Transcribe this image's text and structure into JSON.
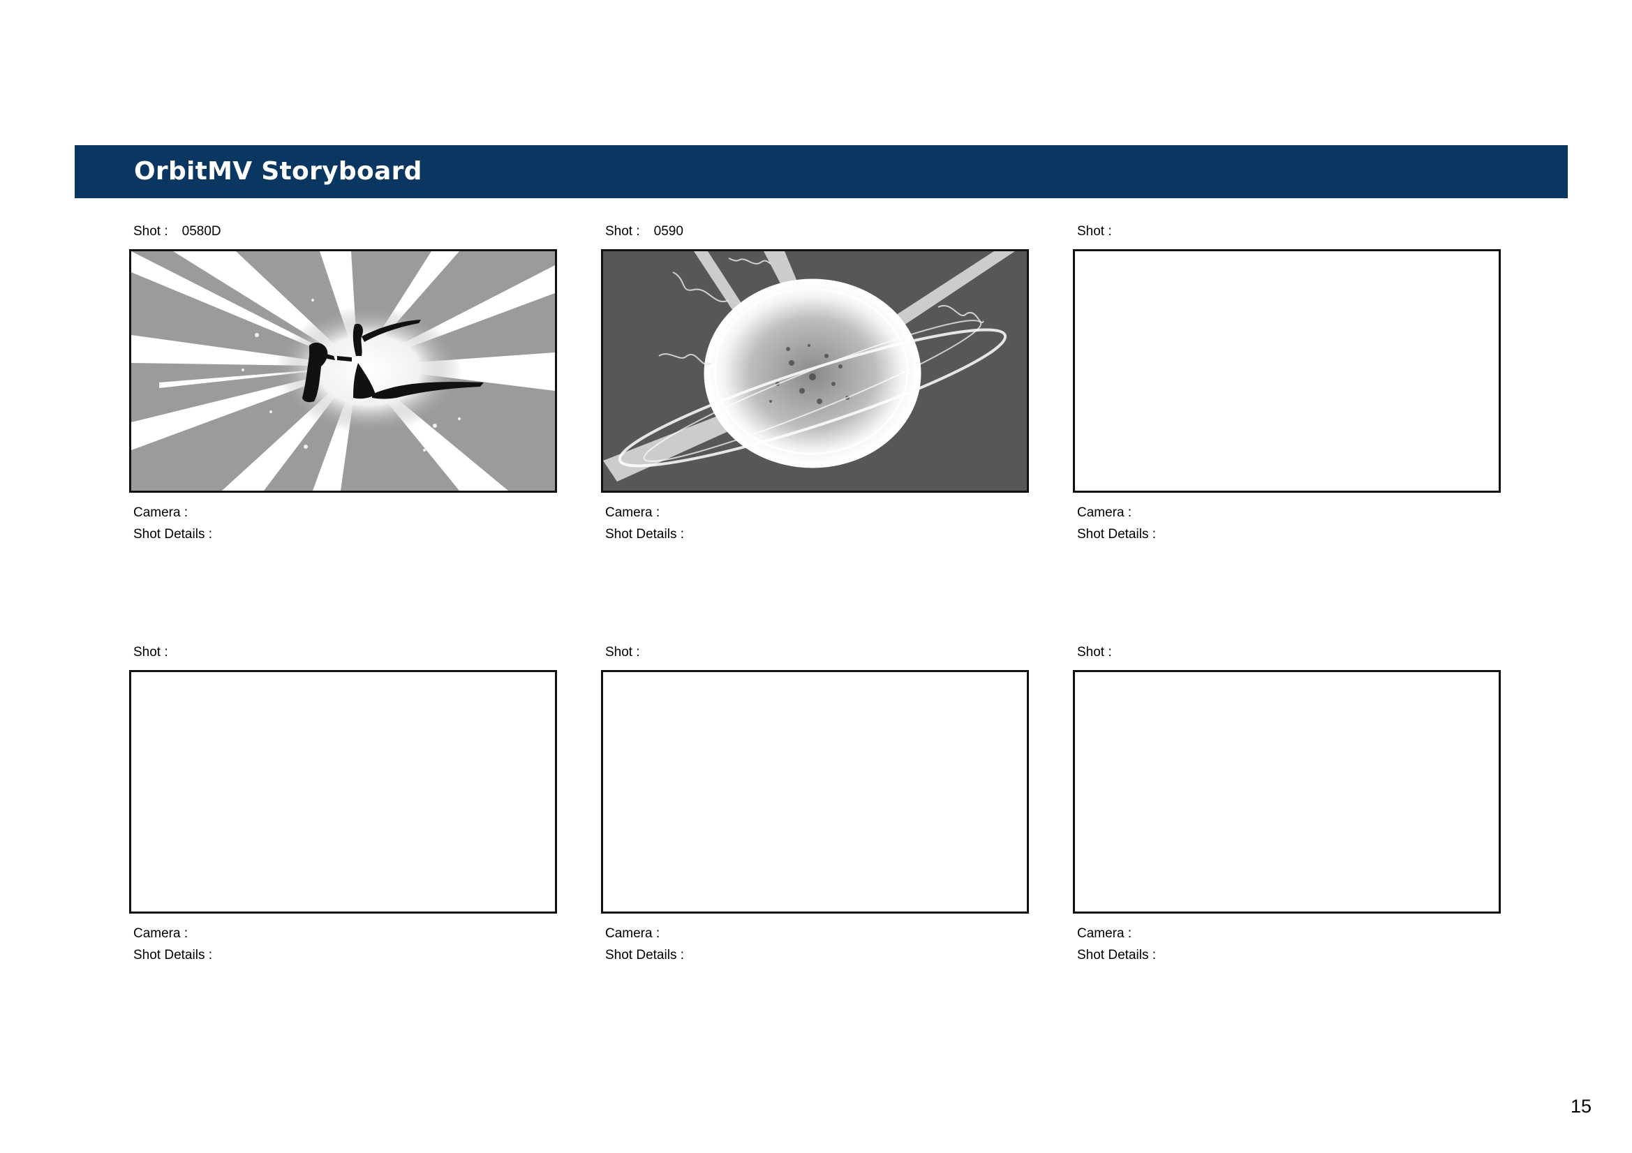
{
  "header": {
    "title": "OrbitMV Storyboard"
  },
  "colors": {
    "header_bg": "#0a3761",
    "header_text": "#ffffff",
    "frame_border": "#111111"
  },
  "labels": {
    "shot": "Shot :",
    "camera": "Camera :",
    "shot_details": "Shot Details :"
  },
  "panels": [
    {
      "shot_value": "0580D",
      "camera_value": "",
      "details_value": "",
      "image": "explosion-burst-silhouette"
    },
    {
      "shot_value": "0590",
      "camera_value": "",
      "details_value": "",
      "image": "glowing-orb-energy-rings"
    },
    {
      "shot_value": "",
      "camera_value": "",
      "details_value": "",
      "image": ""
    },
    {
      "shot_value": "",
      "camera_value": "",
      "details_value": "",
      "image": ""
    },
    {
      "shot_value": "",
      "camera_value": "",
      "details_value": "",
      "image": ""
    },
    {
      "shot_value": "",
      "camera_value": "",
      "details_value": "",
      "image": ""
    }
  ],
  "page_number": "15"
}
